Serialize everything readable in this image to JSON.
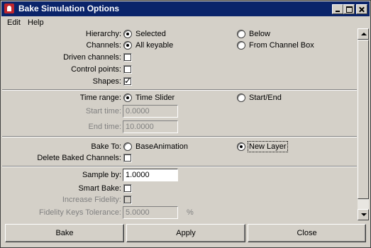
{
  "window": {
    "title": "Bake Simulation Options"
  },
  "menu": [
    "Edit",
    "Help"
  ],
  "hierarchy": {
    "label": "Hierarchy:",
    "opt1": "Selected",
    "opt2": "Below",
    "selected": "Selected"
  },
  "channels": {
    "label": "Channels:",
    "opt1": "All keyable",
    "opt2": "From Channel Box",
    "selected": "All keyable"
  },
  "driven_channels": {
    "label": "Driven channels:",
    "checked": false
  },
  "control_points": {
    "label": "Control points:",
    "checked": false
  },
  "shapes": {
    "label": "Shapes:",
    "checked": true
  },
  "time_range": {
    "label": "Time range:",
    "opt1": "Time Slider",
    "opt2": "Start/End",
    "selected": "Time Slider"
  },
  "start_time": {
    "label": "Start time:",
    "value": "0.0000"
  },
  "end_time": {
    "label": "End time:",
    "value": "10.0000"
  },
  "bake_to": {
    "label": "Bake To:",
    "opt1": "BaseAnimation",
    "opt2": "New Layer",
    "selected": "New Layer"
  },
  "delete_baked": {
    "label": "Delete Baked Channels:",
    "checked": false
  },
  "sample_by": {
    "label": "Sample by:",
    "value": "1.0000"
  },
  "smart_bake": {
    "label": "Smart Bake:",
    "checked": false
  },
  "increase_fidelity": {
    "label": "Increase Fidelity:",
    "checked": false
  },
  "fidelity_tolerance": {
    "label": "Fidelity Keys Tolerance:",
    "value": "5.0000",
    "unit": "%"
  },
  "buttons": {
    "bake": "Bake",
    "apply": "Apply",
    "close": "Close"
  }
}
